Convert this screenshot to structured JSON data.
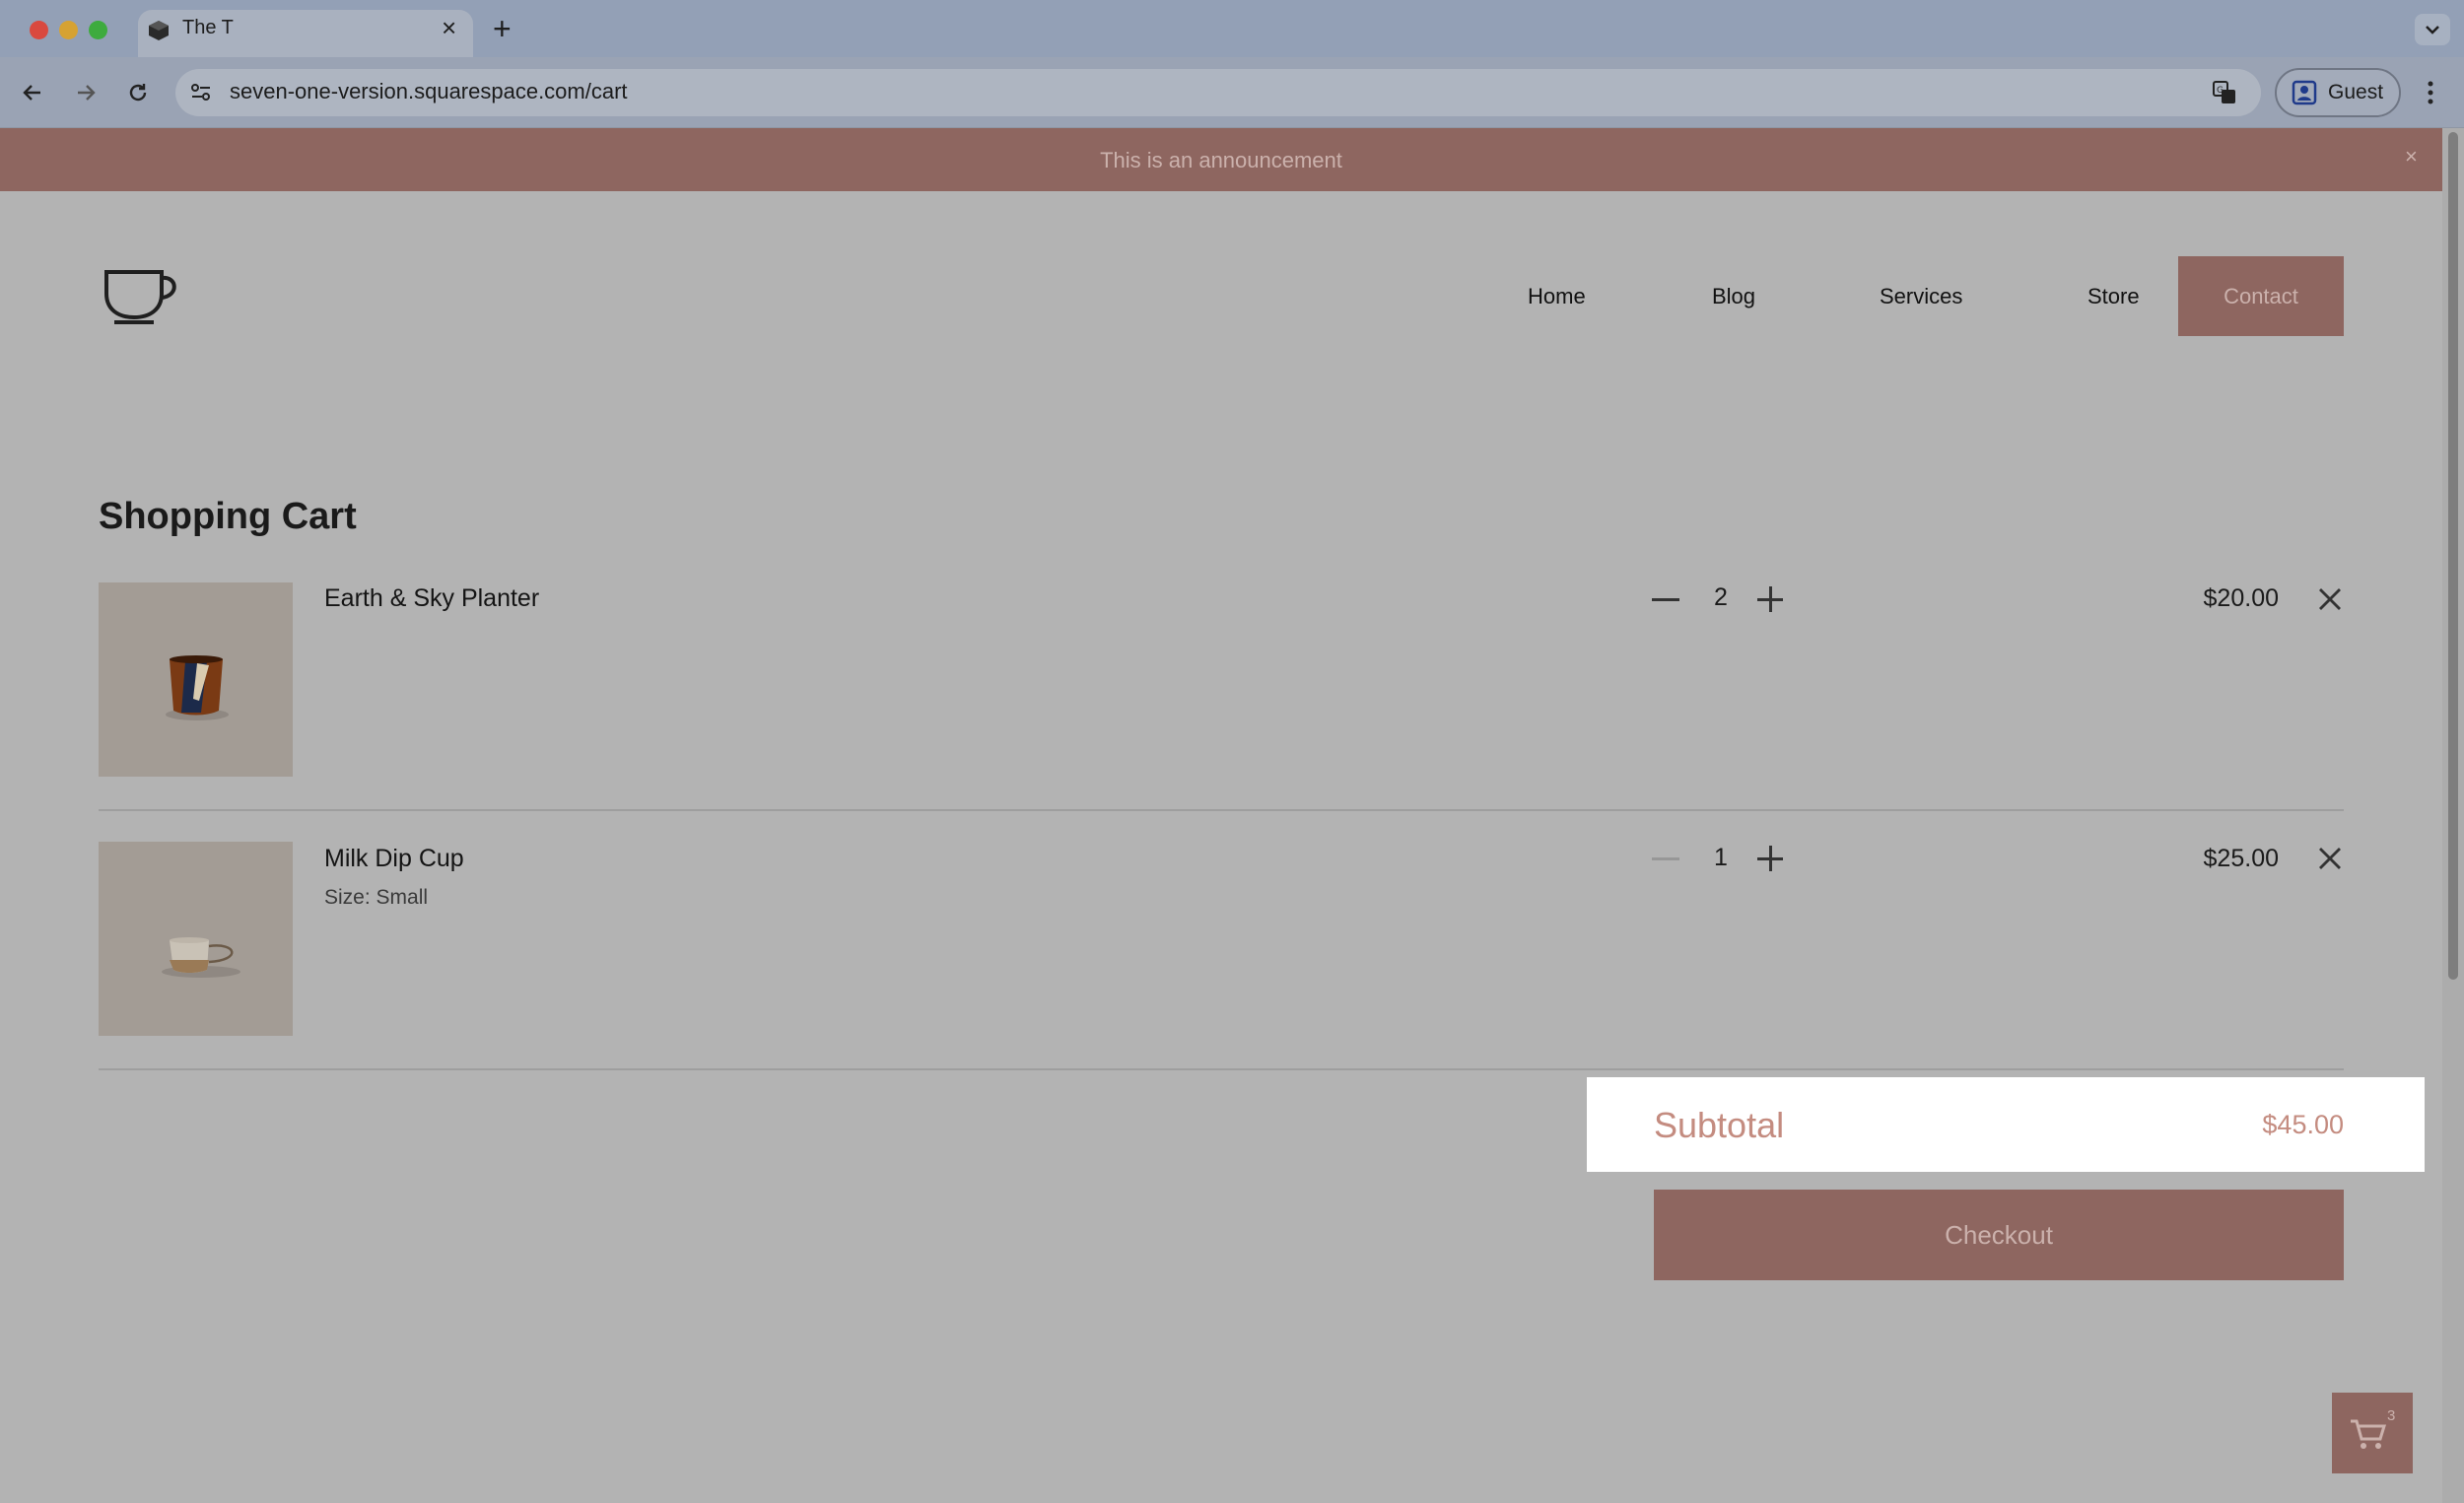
{
  "browser": {
    "tab_title": "The T",
    "url": "seven-one-version.squarespace.com/cart",
    "profile_label": "Guest"
  },
  "announcement": {
    "text": "This is an announcement",
    "close": "×"
  },
  "nav": {
    "items": [
      "Home",
      "Blog",
      "Services",
      "Store"
    ],
    "cta": "Contact"
  },
  "cart": {
    "title": "Shopping Cart",
    "items": [
      {
        "name": "Earth & Sky Planter",
        "variant": "",
        "quantity": "2",
        "price": "$20.00"
      },
      {
        "name": "Milk Dip Cup",
        "variant": "Size: Small",
        "quantity": "1",
        "price": "$25.00"
      }
    ],
    "subtotal_label": "Subtotal",
    "subtotal_value": "$45.00",
    "checkout_label": "Checkout",
    "fab_count": "3"
  },
  "colors": {
    "brand": "#8e6660",
    "brand_text": "#cbb1ac",
    "subtotal": "#c48c80",
    "overlay": "#b3b3b3"
  },
  "icons": [
    "back-icon",
    "forward-icon",
    "reload-icon",
    "site-info-icon",
    "translate-icon",
    "profile-icon",
    "kebab-menu-icon",
    "cup-logo-icon",
    "minus-icon",
    "plus-icon",
    "remove-icon",
    "cart-icon"
  ]
}
